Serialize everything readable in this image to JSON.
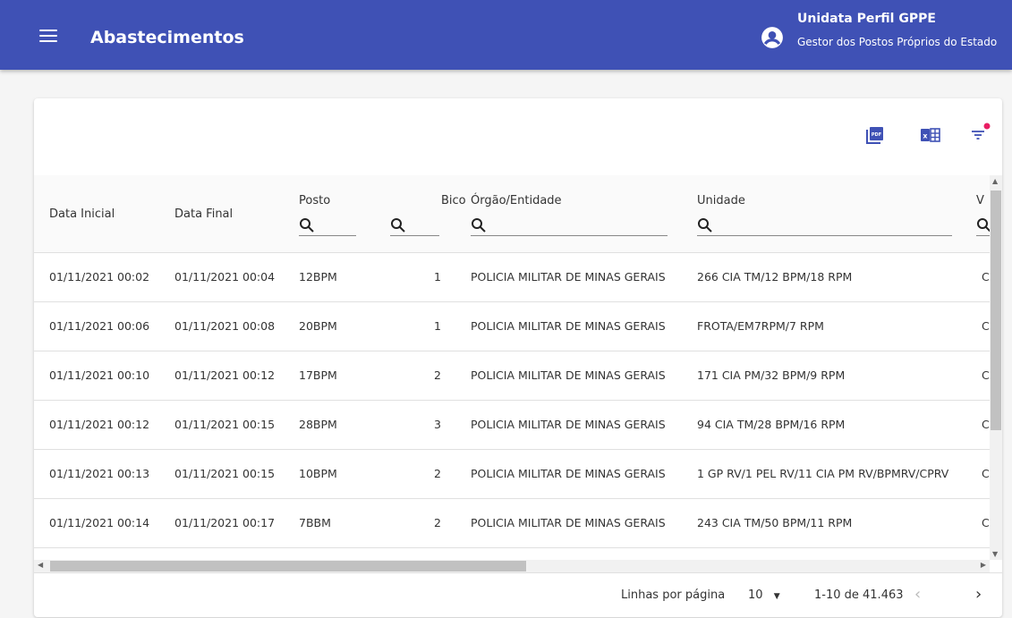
{
  "app": {
    "title": "Abastecimentos"
  },
  "user": {
    "name": "Unidata Perfil GPPE",
    "role": "Gestor dos Postos Próprios do Estado"
  },
  "toolbar": {
    "pdf_icon": "pdf-icon",
    "excel_icon": "excel-icon",
    "filter_icon": "filter-icon",
    "filter_badge_color": "#e91e63"
  },
  "table": {
    "columns": {
      "data_inicial": "Data Inicial",
      "data_final": "Data Final",
      "posto": "Posto",
      "bico": "Bico",
      "orgao": "Órgão/Entidade",
      "unidade": "Unidade",
      "next_partial": "V"
    },
    "rows": [
      {
        "ini": "01/11/2021 00:02",
        "fim": "01/11/2021 00:04",
        "posto": "12BPM",
        "bico": "1",
        "orgao": "POLICIA MILITAR DE MINAS GERAIS",
        "unidade": "266 CIA TM/12 BPM/18 RPM",
        "next": "C"
      },
      {
        "ini": "01/11/2021 00:06",
        "fim": "01/11/2021 00:08",
        "posto": "20BPM",
        "bico": "1",
        "orgao": "POLICIA MILITAR DE MINAS GERAIS",
        "unidade": "FROTA/EM7RPM/7 RPM",
        "next": "C"
      },
      {
        "ini": "01/11/2021 00:10",
        "fim": "01/11/2021 00:12",
        "posto": "17BPM",
        "bico": "2",
        "orgao": "POLICIA MILITAR DE MINAS GERAIS",
        "unidade": "171 CIA PM/32 BPM/9 RPM",
        "next": "C"
      },
      {
        "ini": "01/11/2021 00:12",
        "fim": "01/11/2021 00:15",
        "posto": "28BPM",
        "bico": "3",
        "orgao": "POLICIA MILITAR DE MINAS GERAIS",
        "unidade": "94 CIA TM/28 BPM/16 RPM",
        "next": "C"
      },
      {
        "ini": "01/11/2021 00:13",
        "fim": "01/11/2021 00:15",
        "posto": "10BPM",
        "bico": "2",
        "orgao": "POLICIA MILITAR DE MINAS GERAIS",
        "unidade": "1 GP RV/1 PEL RV/11 CIA PM RV/BPMRV/CPRV",
        "next": "C"
      },
      {
        "ini": "01/11/2021 00:14",
        "fim": "01/11/2021 00:17",
        "posto": "7BBM",
        "bico": "2",
        "orgao": "POLICIA MILITAR DE MINAS GERAIS",
        "unidade": "243 CIA TM/50 BPM/11 RPM",
        "next": "C"
      }
    ]
  },
  "pagination": {
    "rows_per_page_label": "Linhas por página",
    "rows_per_page_value": "10",
    "range": "1-10 de 41.463"
  },
  "colors": {
    "primary": "#3f51b5"
  }
}
